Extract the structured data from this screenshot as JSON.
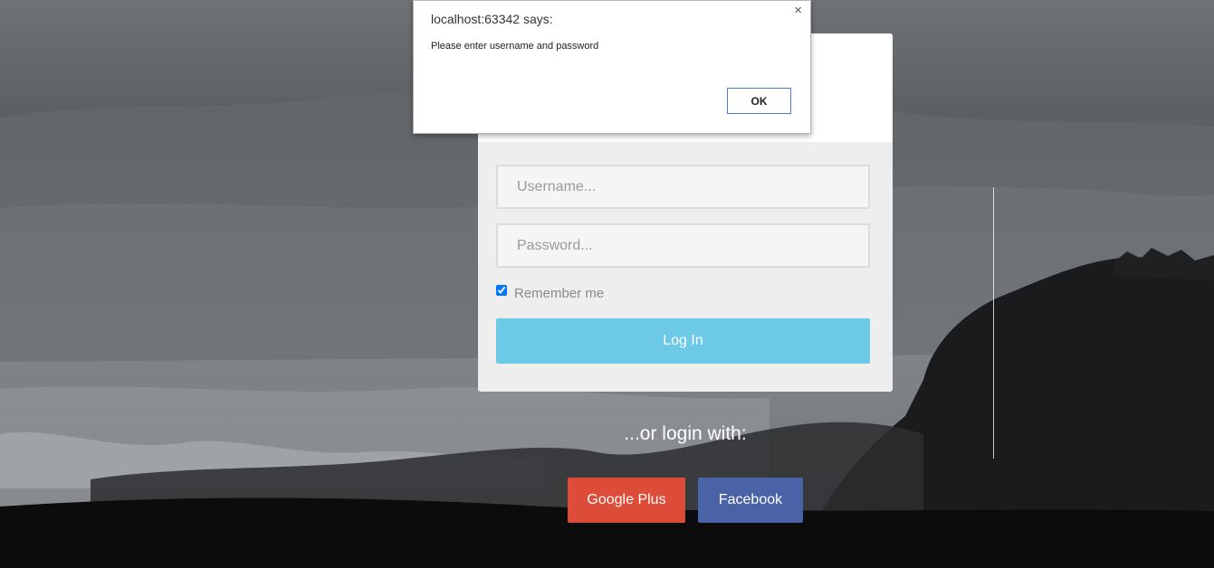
{
  "form": {
    "username_placeholder": "Username...",
    "password_placeholder": "Password...",
    "remember_label": "Remember me",
    "remember_checked": true,
    "login_label": "Log In"
  },
  "social": {
    "prompt": "...or login with:",
    "google_label": "Google Plus",
    "facebook_label": "Facebook"
  },
  "alert": {
    "title": "localhost:63342 says:",
    "message": "Please enter username and password",
    "ok_label": "OK",
    "close_symbol": "×"
  },
  "colors": {
    "login_button": "#6dcae6",
    "google_button": "#dd4b39",
    "facebook_button": "#4a62a6"
  },
  "icons": {
    "alert_close": "close-icon"
  }
}
